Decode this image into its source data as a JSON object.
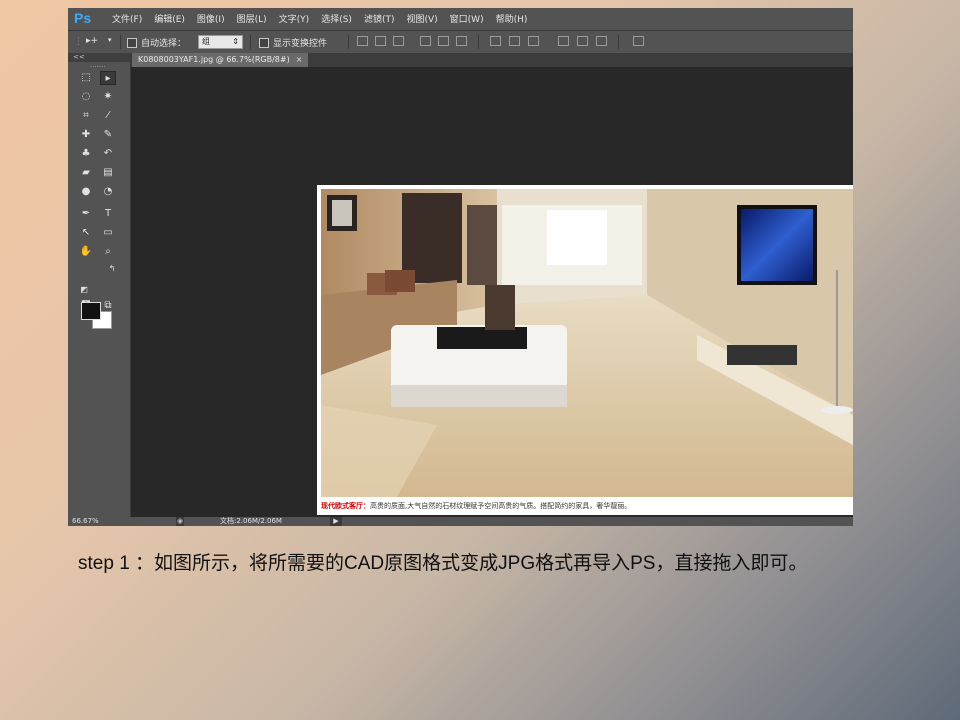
{
  "app": {
    "logo": "Ps",
    "menu": [
      "文件(F)",
      "编辑(E)",
      "图像(I)",
      "图层(L)",
      "文字(Y)",
      "选择(S)",
      "滤镜(T)",
      "视图(V)",
      "窗口(W)",
      "帮助(H)"
    ]
  },
  "options": {
    "move_tool_glyph": "▸+",
    "auto_select_label": "自动选择：",
    "auto_select_value": "组",
    "show_transform_label": "显示变换控件"
  },
  "document": {
    "tab_title": "K0808003YAF1.jpg @ 66.7%(RGB/8#)",
    "tab_close": "×",
    "caption_highlight": "现代欧式客厅：",
    "caption_text": "高贵的质面,大气自然的石材纹理赋予空间高贵的气质。搭配简约的家具，奢华靓丽。"
  },
  "toolbox": {
    "collapse": "<<"
  },
  "status": {
    "zoom": "66.67%",
    "doc_info": "文档:2.06M/2.06M",
    "arrow": "▶"
  },
  "slide": {
    "step_text": "step 1  ：如图所示，将所需要的CAD原图格式变成JPG格式再导入PS，直接拖入即可。"
  },
  "colors": {
    "ps_accent": "#3fa9f5",
    "caption_red": "#cc0000"
  }
}
